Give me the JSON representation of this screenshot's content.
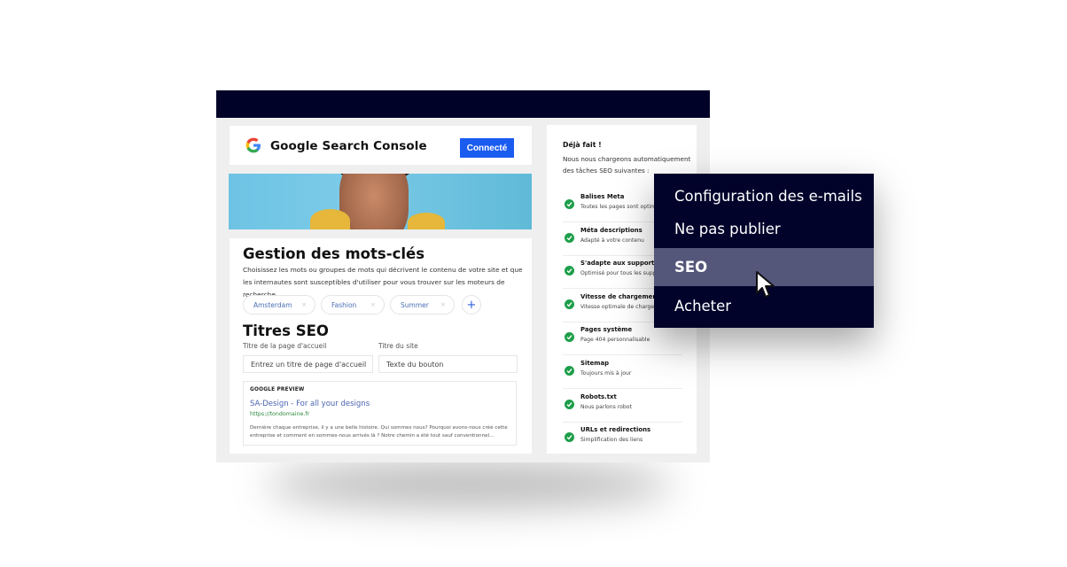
{
  "app": {
    "gsc": {
      "logo_icon": "google-g-icon",
      "title": "Google Search Console",
      "button_label": "Connecté",
      "button_color": "#1a5cf0"
    },
    "keywords": {
      "title": "Gestion des mots-clés",
      "description": "Choisissez les mots ou groupes de mots qui décrivent le contenu de votre site et que les internautes sont susceptibles d'utiliser pour vous trouver sur les moteurs de recherche.",
      "tags": [
        {
          "label": "Amsterdam",
          "remove": "×"
        },
        {
          "label": "Fashion",
          "remove": "×"
        },
        {
          "label": "Summer",
          "remove": "×"
        }
      ],
      "add_icon": "+"
    },
    "seo_titles": {
      "title": "Titres SEO",
      "home_label": "Titre de la page d'accueil",
      "home_placeholder": "Entrez un titre de page d'accueil",
      "site_label": "Titre du site",
      "site_placeholder": "Texte du bouton"
    },
    "preview": {
      "label": "GOOGLE PREVIEW",
      "title": "SA-Design - For all your designs",
      "url": "https://tondomaine.fr",
      "description": "Dernière chaque entreprise, il y a une belle histoire. Qui sommes nous? Pourquoi avons-nous créé cette entreprise et comment en sommes-nous arrivés là ? Notre chemin a été tout sauf conventionnel..."
    },
    "done": {
      "title": "Déjà fait !",
      "description": "Nous nous chargeons automatiquement des tâches SEO suivantes :",
      "tasks": [
        {
          "name": "Balises Meta",
          "sub": "Toutes les pages sont optimisées"
        },
        {
          "name": "Méta descriptions",
          "sub": "Adapté à votre contenu"
        },
        {
          "name": "S'adapte aux supports",
          "sub": "Optimisé pour tous les supports"
        },
        {
          "name": "Vitesse de chargement",
          "sub": "Vitesse optimale de chargement"
        },
        {
          "name": "Pages système",
          "sub": "Page 404 personnalisable"
        },
        {
          "name": "Sitemap",
          "sub": "Toujours mis à jour"
        },
        {
          "name": "Robots.txt",
          "sub": "Nous parlons robot"
        },
        {
          "name": "URLs et redirections",
          "sub": "Simplification des liens"
        }
      ]
    }
  },
  "menu": {
    "items": [
      {
        "label": "Configuration des e-mails"
      },
      {
        "label": "Ne pas publier"
      },
      {
        "label": "SEO",
        "active": true
      },
      {
        "label": "Acheter"
      }
    ],
    "background": "#02032b",
    "active_background": "#54567a"
  }
}
